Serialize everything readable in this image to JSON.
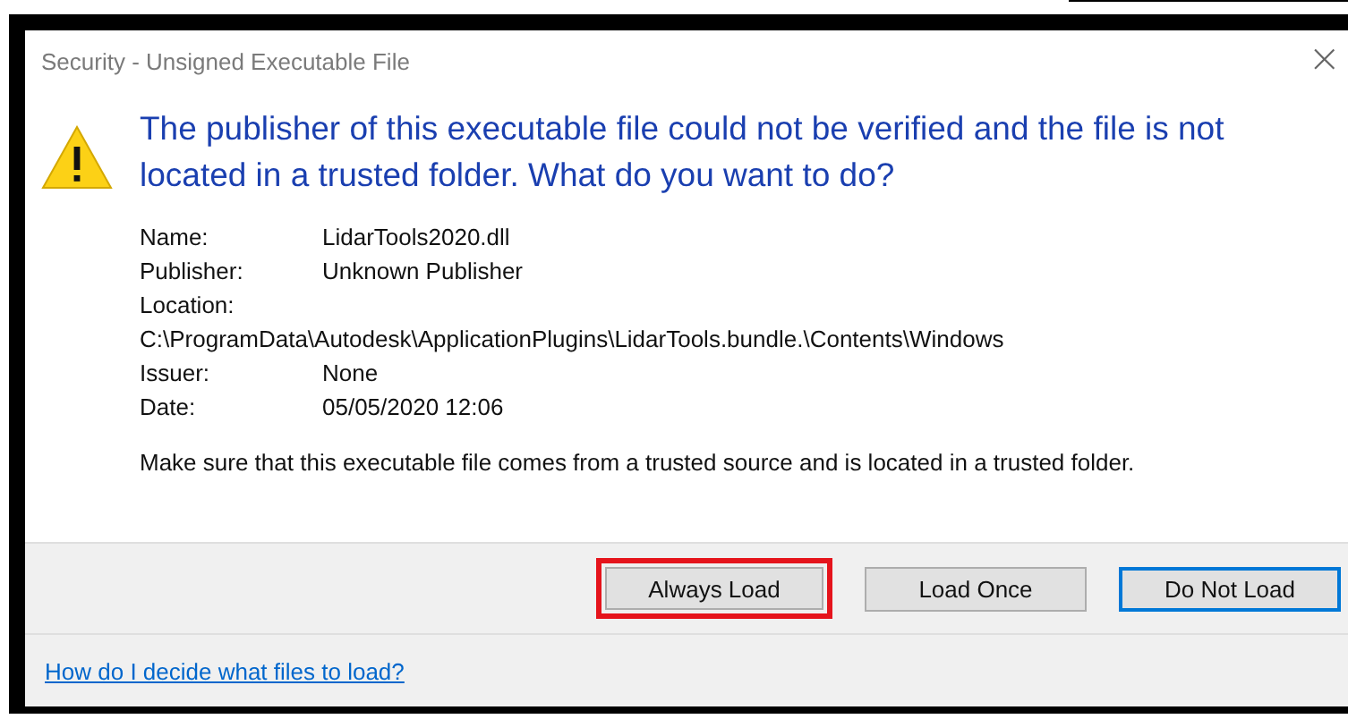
{
  "window": {
    "title": "Security - Unsigned Executable File",
    "close": "×"
  },
  "message": "The publisher of this executable file could not be verified and the file is not located in a trusted folder. What do you want to do?",
  "details": [
    {
      "label": "Name:",
      "value": "LidarTools2020.dll",
      "kind": "inline"
    },
    {
      "label": "Publisher:",
      "value": "Unknown Publisher",
      "kind": "inline"
    },
    {
      "label": "Location:",
      "value": "C:\\ProgramData\\Autodesk\\ApplicationPlugins\\LidarTools.bundle.\\Contents\\Windows",
      "kind": "wrapped"
    },
    {
      "label": "Issuer:",
      "value": "None",
      "kind": "inline"
    },
    {
      "label": "Date:",
      "value": "05/05/2020  12:06",
      "kind": "inline"
    }
  ],
  "advice": "Make sure that this executable file comes from a trusted source and is located in a trusted folder.",
  "buttons": [
    {
      "label": "Always Load",
      "highlighted": true,
      "default": false
    },
    {
      "label": "Load Once",
      "highlighted": false,
      "default": false
    },
    {
      "label": "Do Not Load",
      "highlighted": false,
      "default": true
    }
  ],
  "help_link": "How do I decide what files to load?"
}
